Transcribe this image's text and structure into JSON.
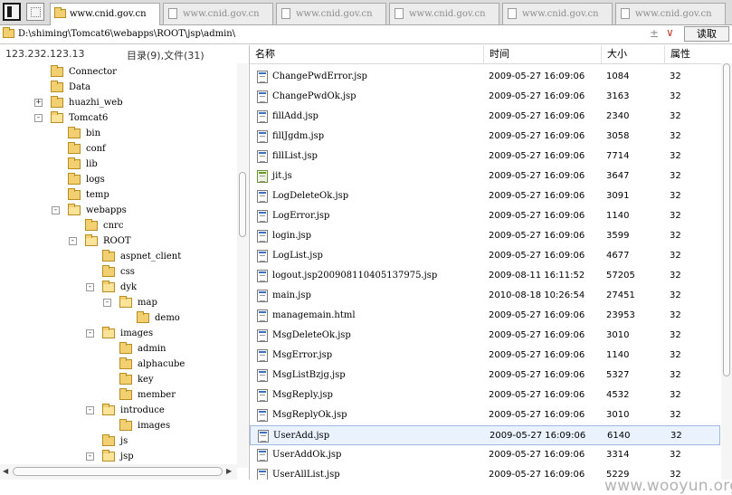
{
  "tabs": [
    {
      "label": "www.cnid.gov.cn",
      "active": true
    },
    {
      "label": "www.cnid.gov.cn",
      "active": false
    },
    {
      "label": "www.cnid.gov.cn",
      "active": false
    },
    {
      "label": "www.cnid.gov.cn",
      "active": false
    },
    {
      "label": "www.cnid.gov.cn",
      "active": false
    },
    {
      "label": "www.cnid.gov.cn",
      "active": false
    }
  ],
  "pathbar": {
    "path": "D:\\shiming\\Tomcat6\\webapps\\ROOT\\jsp\\admin\\",
    "read_label": "读取"
  },
  "left": {
    "ip": "123.232.123.13",
    "count": "目录(9),文件(31)"
  },
  "tree": [
    {
      "label": "Connector",
      "depth": 0,
      "exp": ""
    },
    {
      "label": "Data",
      "depth": 0,
      "exp": ""
    },
    {
      "label": "huazhi_web",
      "depth": 0,
      "exp": "+"
    },
    {
      "label": "Tomcat6",
      "depth": 0,
      "exp": "−",
      "open": true
    },
    {
      "label": "bin",
      "depth": 1,
      "exp": ""
    },
    {
      "label": "conf",
      "depth": 1,
      "exp": ""
    },
    {
      "label": "lib",
      "depth": 1,
      "exp": ""
    },
    {
      "label": "logs",
      "depth": 1,
      "exp": ""
    },
    {
      "label": "temp",
      "depth": 1,
      "exp": ""
    },
    {
      "label": "webapps",
      "depth": 1,
      "exp": "−",
      "open": true
    },
    {
      "label": "cnrc",
      "depth": 2,
      "exp": ""
    },
    {
      "label": "ROOT",
      "depth": 2,
      "exp": "−",
      "open": true
    },
    {
      "label": "aspnet_client",
      "depth": 3,
      "exp": ""
    },
    {
      "label": "css",
      "depth": 3,
      "exp": ""
    },
    {
      "label": "dyk",
      "depth": 3,
      "exp": "−",
      "open": true
    },
    {
      "label": "map",
      "depth": 4,
      "exp": "−",
      "open": true
    },
    {
      "label": "demo",
      "depth": 5,
      "exp": ""
    },
    {
      "label": "images",
      "depth": 3,
      "exp": "−",
      "open": true
    },
    {
      "label": "admin",
      "depth": 4,
      "exp": ""
    },
    {
      "label": "alphacube",
      "depth": 4,
      "exp": ""
    },
    {
      "label": "key",
      "depth": 4,
      "exp": ""
    },
    {
      "label": "member",
      "depth": 4,
      "exp": ""
    },
    {
      "label": "introduce",
      "depth": 3,
      "exp": "−",
      "open": true
    },
    {
      "label": "images",
      "depth": 4,
      "exp": ""
    },
    {
      "label": "js",
      "depth": 3,
      "exp": ""
    },
    {
      "label": "jsp",
      "depth": 3,
      "exp": "−",
      "open": true
    }
  ],
  "columns": {
    "name": "名称",
    "time": "时间",
    "size": "大小",
    "attr": "属性"
  },
  "files": [
    {
      "name": "ChangePwdError.jsp",
      "time": "2009-05-27 16:09:06",
      "size": "1084",
      "attr": "32",
      "type": "jsp"
    },
    {
      "name": "ChangePwdOk.jsp",
      "time": "2009-05-27 16:09:06",
      "size": "3163",
      "attr": "32",
      "type": "jsp"
    },
    {
      "name": "fillAdd.jsp",
      "time": "2009-05-27 16:09:06",
      "size": "2340",
      "attr": "32",
      "type": "jsp"
    },
    {
      "name": "fillJgdm.jsp",
      "time": "2009-05-27 16:09:06",
      "size": "3058",
      "attr": "32",
      "type": "jsp"
    },
    {
      "name": "fillList.jsp",
      "time": "2009-05-27 16:09:06",
      "size": "7714",
      "attr": "32",
      "type": "jsp"
    },
    {
      "name": "jit.js",
      "time": "2009-05-27 16:09:06",
      "size": "3647",
      "attr": "32",
      "type": "js"
    },
    {
      "name": "LogDeleteOk.jsp",
      "time": "2009-05-27 16:09:06",
      "size": "3091",
      "attr": "32",
      "type": "jsp"
    },
    {
      "name": "LogError.jsp",
      "time": "2009-05-27 16:09:06",
      "size": "1140",
      "attr": "32",
      "type": "jsp"
    },
    {
      "name": "login.jsp",
      "time": "2009-05-27 16:09:06",
      "size": "3599",
      "attr": "32",
      "type": "jsp"
    },
    {
      "name": "LogList.jsp",
      "time": "2009-05-27 16:09:06",
      "size": "4677",
      "attr": "32",
      "type": "jsp"
    },
    {
      "name": "logout.jsp200908110405137975.jsp",
      "time": "2009-08-11 16:11:52",
      "size": "57205",
      "attr": "32",
      "type": "jsp"
    },
    {
      "name": "main.jsp",
      "time": "2010-08-18 10:26:54",
      "size": "27451",
      "attr": "32",
      "type": "jsp"
    },
    {
      "name": "managemain.html",
      "time": "2009-05-27 16:09:06",
      "size": "23953",
      "attr": "32",
      "type": "jsp"
    },
    {
      "name": "MsgDeleteOk.jsp",
      "time": "2009-05-27 16:09:06",
      "size": "3010",
      "attr": "32",
      "type": "jsp"
    },
    {
      "name": "MsgError.jsp",
      "time": "2009-05-27 16:09:06",
      "size": "1140",
      "attr": "32",
      "type": "jsp"
    },
    {
      "name": "MsgListBzjg.jsp",
      "time": "2009-05-27 16:09:06",
      "size": "5327",
      "attr": "32",
      "type": "jsp"
    },
    {
      "name": "MsgReply.jsp",
      "time": "2009-05-27 16:09:06",
      "size": "4532",
      "attr": "32",
      "type": "jsp"
    },
    {
      "name": "MsgReplyOk.jsp",
      "time": "2009-05-27 16:09:06",
      "size": "3010",
      "attr": "32",
      "type": "jsp"
    },
    {
      "name": "UserAdd.jsp",
      "time": "2009-05-27 16:09:06",
      "size": "6140",
      "attr": "32",
      "type": "jsp",
      "selected": true
    },
    {
      "name": "UserAddOk.jsp",
      "time": "2009-05-27 16:09:06",
      "size": "3314",
      "attr": "32",
      "type": "jsp"
    },
    {
      "name": "UserAllList.jsp",
      "time": "2009-05-27 16:09:06",
      "size": "5229",
      "attr": "32",
      "type": "jsp"
    }
  ],
  "watermark": "www.wooyun.org",
  "colors": {
    "folder": "#f2d071",
    "selection": "#eaf2fd",
    "accent": "#c0392b"
  },
  "icons": {
    "folder": "folder-icon",
    "file": "jsp-file-icon",
    "js": "js-file-icon",
    "expand": "expand-toggle-icon"
  }
}
